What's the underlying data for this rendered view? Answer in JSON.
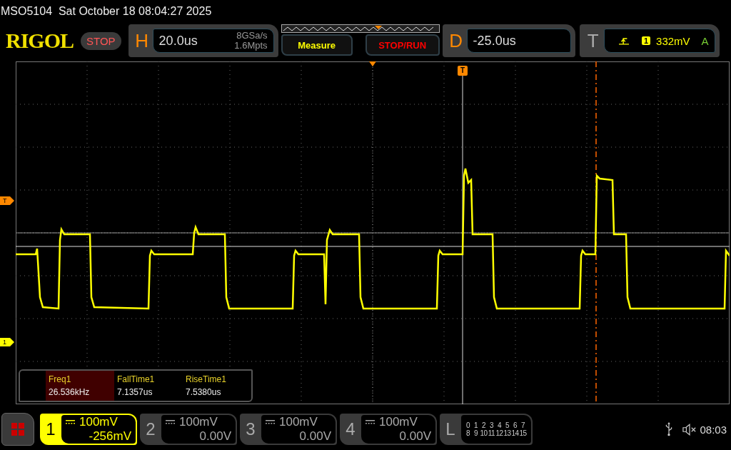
{
  "status_line": {
    "model": "MSO5104",
    "datetime": "Sat October 18 08:04:27 2025"
  },
  "header": {
    "logo": "RIGOL",
    "run_state": "STOP",
    "horizontal": {
      "letter": "H",
      "timebase": "20.0us",
      "sample_rate": "8GSa/s",
      "memory_depth": "1.6Mpts"
    },
    "buttons": [
      "Measure",
      "STOP/RUN"
    ],
    "delay": {
      "letter": "D",
      "value": "-25.0us"
    },
    "trigger": {
      "letter": "T",
      "source": "1",
      "level": "332mV",
      "mode": "A"
    }
  },
  "graticule": {
    "trigger_position_marker": "T",
    "trigger_level_marker": "T",
    "channel_marker": "1"
  },
  "measurements": [
    {
      "name": "Freq1",
      "value": "26.536kHz",
      "selected": true
    },
    {
      "name": "FallTime1",
      "value": "7.1357us",
      "selected": false
    },
    {
      "name": "RiseTime1",
      "value": "7.5380us",
      "selected": false
    }
  ],
  "channels": [
    {
      "number": "1",
      "scale": "100mV",
      "offset": "-256mV",
      "active": true
    },
    {
      "number": "2",
      "scale": "100mV",
      "offset": "0.00V",
      "active": false
    },
    {
      "number": "3",
      "scale": "100mV",
      "offset": "0.00V",
      "active": false
    },
    {
      "number": "4",
      "scale": "100mV",
      "offset": "0.00V",
      "active": false
    }
  ],
  "logic": {
    "letter": "L",
    "rows": [
      [
        "0",
        "1",
        "2",
        "3",
        "4",
        "5",
        "6",
        "7"
      ],
      [
        "8",
        "9",
        "10",
        "11",
        "12",
        "13",
        "14",
        "15"
      ]
    ]
  },
  "status": {
    "time": "08:03"
  }
}
